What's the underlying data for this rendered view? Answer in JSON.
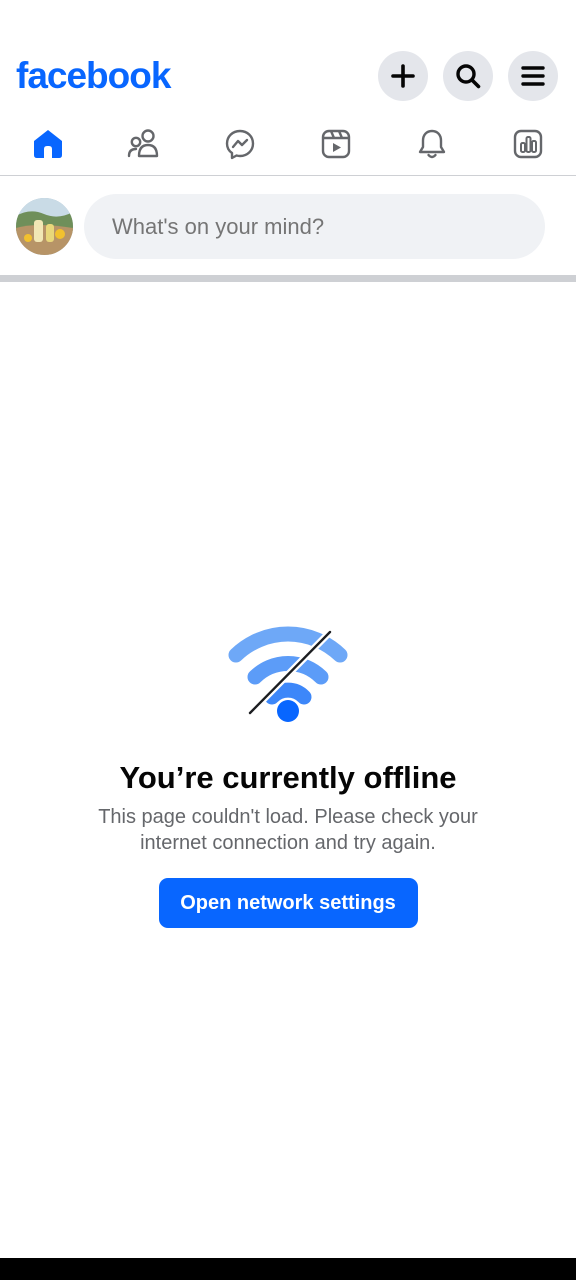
{
  "header": {
    "logo_text": "facebook",
    "buttons": [
      {
        "name": "create",
        "icon": "plus-icon"
      },
      {
        "name": "search",
        "icon": "search-icon"
      },
      {
        "name": "menu",
        "icon": "hamburger-menu-icon"
      }
    ]
  },
  "tabs": [
    {
      "name": "home",
      "icon": "home-icon",
      "active": true
    },
    {
      "name": "friends",
      "icon": "friends-icon",
      "active": false
    },
    {
      "name": "messenger",
      "icon": "messenger-icon",
      "active": false
    },
    {
      "name": "video",
      "icon": "video-icon",
      "active": false
    },
    {
      "name": "notifications",
      "icon": "bell-icon",
      "active": false
    },
    {
      "name": "dashboard",
      "icon": "dashboard-icon",
      "active": false
    }
  ],
  "composer": {
    "placeholder": "What's on your mind?"
  },
  "offline": {
    "icon": "wifi-off-icon",
    "title": "You’re currently offline",
    "message": "This page couldn't load. Please check your internet connection and try again.",
    "button_label": "Open network settings"
  },
  "colors": {
    "brand": "#0866ff",
    "wifi_light": "#6ea8f7",
    "button_bg": "#e4e6eb",
    "input_bg": "#f0f2f5",
    "secondary_text": "#65676b"
  }
}
